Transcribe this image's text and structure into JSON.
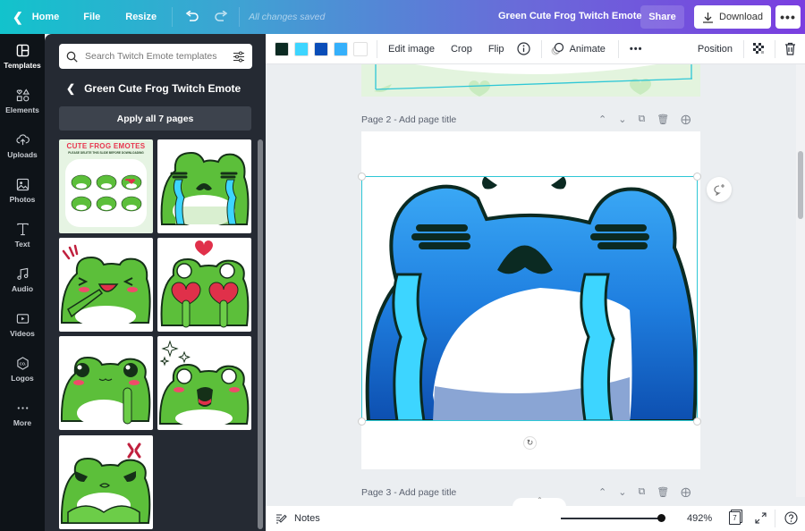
{
  "topbar": {
    "home_label": "Home",
    "file_label": "File",
    "resize_label": "Resize",
    "save_status": "All changes saved",
    "document_title": "Green Cute Frog Twitch Emote",
    "share_label": "Share",
    "download_label": "Download",
    "more_label": "•••"
  },
  "rail": {
    "items": [
      {
        "label": "Templates",
        "icon": "templates-icon"
      },
      {
        "label": "Elements",
        "icon": "elements-icon"
      },
      {
        "label": "Uploads",
        "icon": "upload-cloud-icon"
      },
      {
        "label": "Photos",
        "icon": "photo-icon"
      },
      {
        "label": "Text",
        "icon": "text-icon"
      },
      {
        "label": "Audio",
        "icon": "music-note-icon"
      },
      {
        "label": "Videos",
        "icon": "video-icon"
      },
      {
        "label": "Logos",
        "icon": "logo-icon"
      },
      {
        "label": "More",
        "icon": "more-dots-icon"
      }
    ]
  },
  "panel": {
    "search_placeholder": "Search Twitch Emote templates",
    "template_title": "Green Cute Frog Twitch Emote",
    "apply_label": "Apply all 7 pages",
    "thumbnails": [
      {
        "name": "cover",
        "heading": "CUTE FROG EMOTES",
        "subheading": "PLEASE DELETE THIS SLIDE BEFORE DOWNLOADING"
      },
      {
        "name": "crying"
      },
      {
        "name": "laughing"
      },
      {
        "name": "love-eyes"
      },
      {
        "name": "shy"
      },
      {
        "name": "excited"
      },
      {
        "name": "angry"
      }
    ]
  },
  "context_toolbar": {
    "swatches": [
      "#0b2a22",
      "#3dd5ff",
      "#0a4db8",
      "#35b0fb",
      "#ffffff"
    ],
    "edit_image": "Edit image",
    "crop": "Crop",
    "flip": "Flip",
    "animate": "Animate",
    "more": "•••",
    "position": "Position"
  },
  "canvas": {
    "page2_label": "Page 2 - Add page title",
    "page3_label": "Page 3 - Add page title"
  },
  "bottombar": {
    "notes_label": "Notes",
    "zoom_level": "492%",
    "zoom_fraction": 1.0,
    "page_count": "7"
  },
  "colors": {
    "selection": "#2ec7d6",
    "frog_blue": "#1f7fe0",
    "frog_light_blue": "#3dd5ff",
    "frog_dark": "#0b2a22"
  }
}
